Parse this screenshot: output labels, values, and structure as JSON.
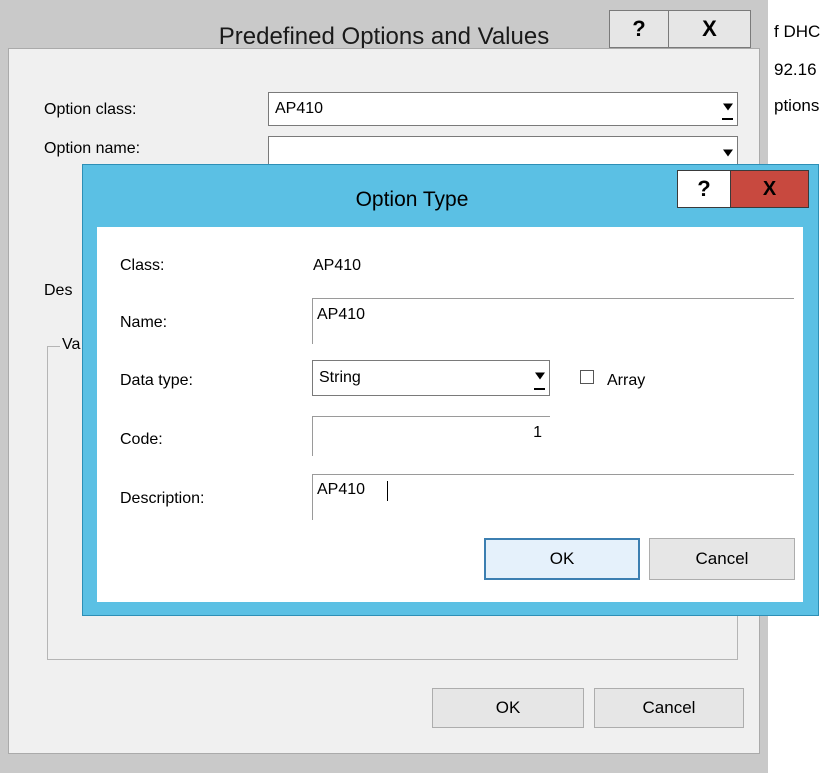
{
  "background_window": {
    "lines": [
      "f DHC",
      "92.16",
      "ptions"
    ]
  },
  "outer_dialog": {
    "title": "Predefined Options and Values",
    "help_symbol": "?",
    "close_symbol": "X",
    "option_class_label": "Option class:",
    "option_class_value": "AP410",
    "option_name_label": "Option name:",
    "option_name_value": "",
    "description_label_partial": "Des",
    "value_group_label_partial": "Va",
    "ok_label": "OK",
    "cancel_label": "Cancel"
  },
  "inner_dialog": {
    "title": "Option Type",
    "help_symbol": "?",
    "close_symbol": "X",
    "class_label": "Class:",
    "class_value": "AP410",
    "name_label": "Name:",
    "name_value": "AP410",
    "data_type_label": "Data type:",
    "data_type_value": "String",
    "array_label": "Array",
    "array_checked": false,
    "code_label": "Code:",
    "code_value": "1",
    "description_label": "Description:",
    "description_value": "AP410",
    "ok_label": "OK",
    "cancel_label": "Cancel"
  },
  "colors": {
    "active_title_bar": "#5bc0e4",
    "close_button_red": "#c8493f",
    "inactive_frame": "#c9c9c9"
  }
}
